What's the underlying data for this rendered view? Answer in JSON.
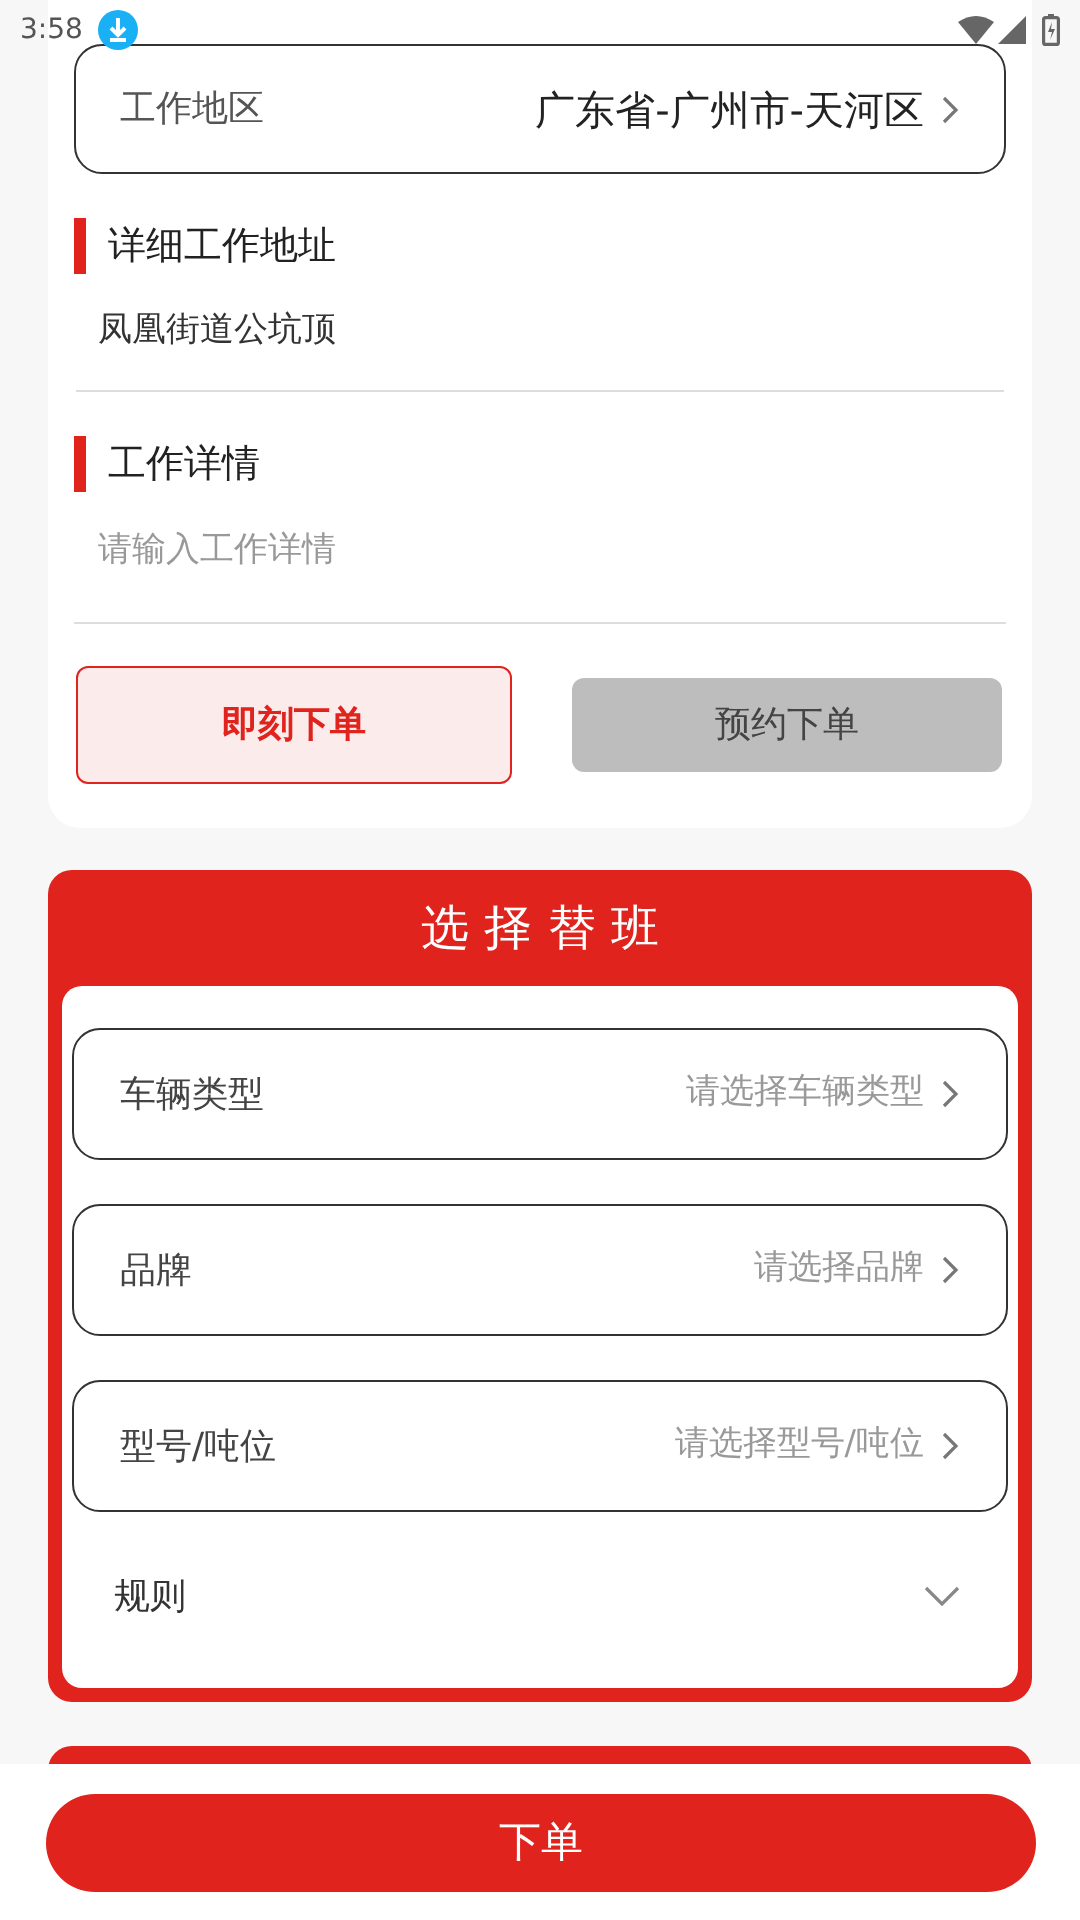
{
  "status_bar": {
    "time": "3:58"
  },
  "work_region": {
    "label": "工作地区",
    "value": "广东省-广州市-天河区"
  },
  "address": {
    "title": "详细工作地址",
    "value": "凤凰街道公坑顶"
  },
  "details": {
    "title": "工作详情",
    "placeholder": "请输入工作详情"
  },
  "order_modes": [
    {
      "label": "即刻下单",
      "selected": true
    },
    {
      "label": "预约下单",
      "selected": false
    }
  ],
  "shift_section": {
    "title": "选 择 替 班",
    "selectors": [
      {
        "label": "车辆类型",
        "placeholder": "请选择车辆类型"
      },
      {
        "label": "品牌",
        "placeholder": "请选择品牌"
      },
      {
        "label": "型号/吨位",
        "placeholder": "请选择型号/吨位"
      }
    ],
    "rules": {
      "label": "规则",
      "expanded": false
    }
  },
  "submit_button": {
    "label": "下单"
  }
}
